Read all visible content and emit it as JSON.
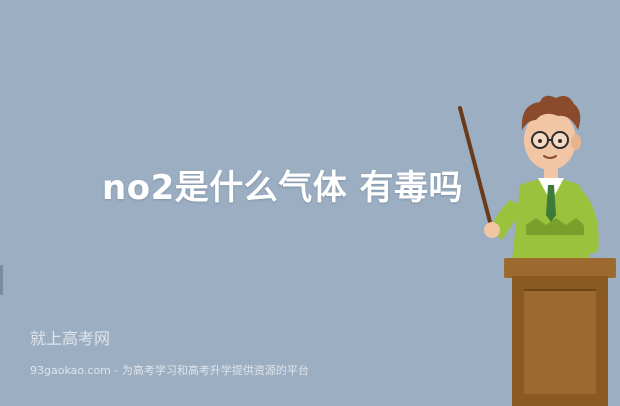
{
  "banner": {
    "background_color": "#9baec2",
    "headline": "no2是什么气体 有毒吗",
    "site_name": "就上高考网",
    "tagline": "93gaokao.com - 为高考学习和高考升学提供资源的平台"
  },
  "illustration": {
    "subject": "teacher-with-pointer-at-lectern",
    "colors": {
      "hair": "#8a4a2c",
      "skin": "#f2c6a4",
      "sweater": "#9bc23c",
      "shirt": "#ffffff",
      "lectern": "#9c6a2e",
      "pointer": "#6b3a1a"
    }
  }
}
